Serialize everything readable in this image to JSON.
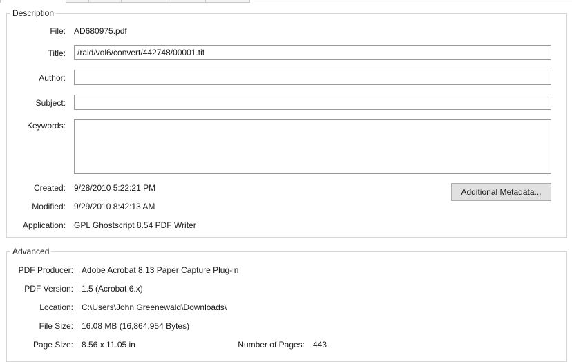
{
  "description": {
    "legend": "Description",
    "file_label": "File:",
    "file_value": "AD680975.pdf",
    "title_label": "Title:",
    "title_value": "/raid/vol6/convert/442748/00001.tif",
    "author_label": "Author:",
    "author_value": "",
    "subject_label": "Subject:",
    "subject_value": "",
    "keywords_label": "Keywords:",
    "keywords_value": "",
    "created_label": "Created:",
    "created_value": "9/28/2010 5:22:21 PM",
    "modified_label": "Modified:",
    "modified_value": "9/29/2010 8:42:13 AM",
    "application_label": "Application:",
    "application_value": "GPL Ghostscript 8.54 PDF Writer",
    "metadata_button": "Additional Metadata..."
  },
  "advanced": {
    "legend": "Advanced",
    "producer_label": "PDF Producer:",
    "producer_value": "Adobe Acrobat 8.13 Paper Capture Plug-in",
    "version_label": "PDF Version:",
    "version_value": "1.5 (Acrobat 6.x)",
    "location_label": "Location:",
    "location_value": "C:\\Users\\John Greenewald\\Downloads\\",
    "filesize_label": "File Size:",
    "filesize_value": "16.08 MB (16,864,954 Bytes)",
    "pagesize_label": "Page Size:",
    "pagesize_value": "8.56 x 11.05 in",
    "pages_label": "Number of Pages:",
    "pages_value": "443"
  }
}
